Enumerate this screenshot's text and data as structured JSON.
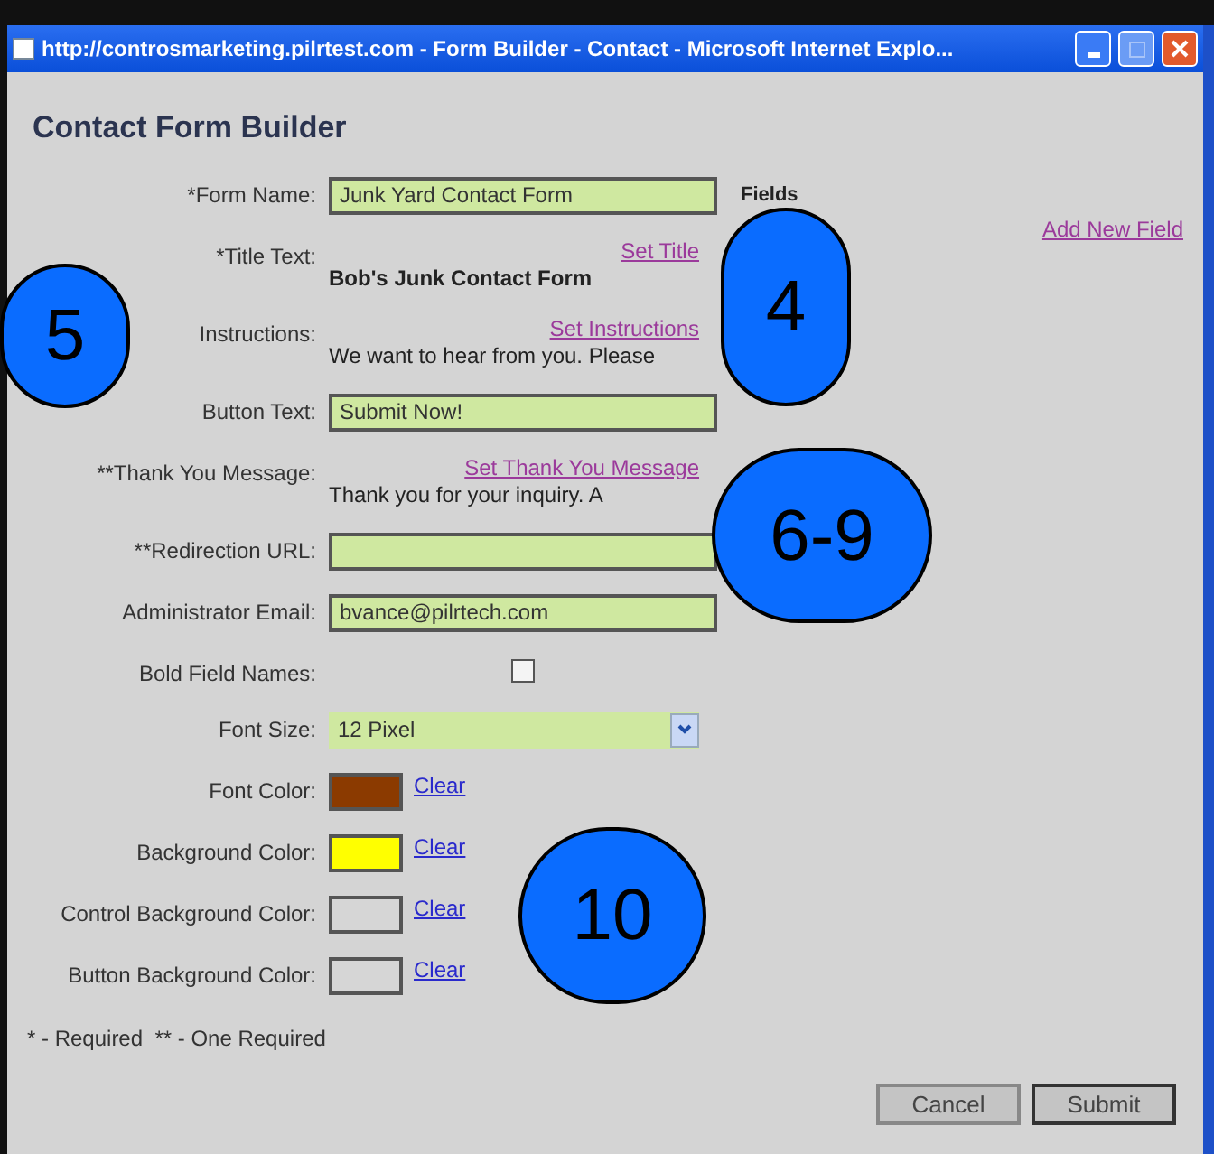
{
  "window": {
    "title": "http://controsmarketing.pilrtest.com - Form Builder - Contact - Microsoft Internet Explo..."
  },
  "heading": "Contact Form Builder",
  "fields": [
    {
      "kind": "input",
      "label": "*Form Name:",
      "value": "Junk Yard Contact Form"
    },
    {
      "kind": "text",
      "label": "*Title Text:",
      "link": "Set Title",
      "text": "Bob's Junk Contact Form",
      "bold": true
    },
    {
      "kind": "text",
      "label": "Instructions:",
      "link": "Set Instructions",
      "text": "We want to hear from you. Please",
      "bold": false
    },
    {
      "kind": "input",
      "label": "Button Text:",
      "value": "Submit Now!"
    },
    {
      "kind": "text",
      "label": "**Thank You Message:",
      "link": "Set Thank You Message",
      "text": "Thank you for your inquiry. A",
      "bold": false
    },
    {
      "kind": "input",
      "label": "**Redirection URL:"
    },
    {
      "kind": "input",
      "label": "Administrator Email:",
      "value": "bvance@pilrtech.com"
    },
    {
      "kind": "checkbox",
      "label": "Bold Field Names:",
      "checked": false
    },
    {
      "kind": "select",
      "label": "Font Size:",
      "value": "12 Pixel"
    },
    {
      "kind": "color",
      "label": "Font Color:",
      "color": "#8b3a00",
      "link": "Clear"
    },
    {
      "kind": "color",
      "label": "Background Color:",
      "color": "#ffff00",
      "link": "Clear"
    },
    {
      "kind": "color",
      "label": "Control Background Color:",
      "color": "#d6d6d6",
      "link": "Clear"
    },
    {
      "kind": "color",
      "label": "Button Background Color:",
      "color": "#d6d6d6",
      "link": "Clear"
    }
  ],
  "legend": "* - Required  ** - One Required",
  "fields_panel": {
    "heading": "Fields",
    "link": "Add New Field"
  },
  "buttons": [
    "Cancel",
    "Submit"
  ],
  "callouts": [
    "5",
    "4",
    "6-9",
    "10"
  ]
}
